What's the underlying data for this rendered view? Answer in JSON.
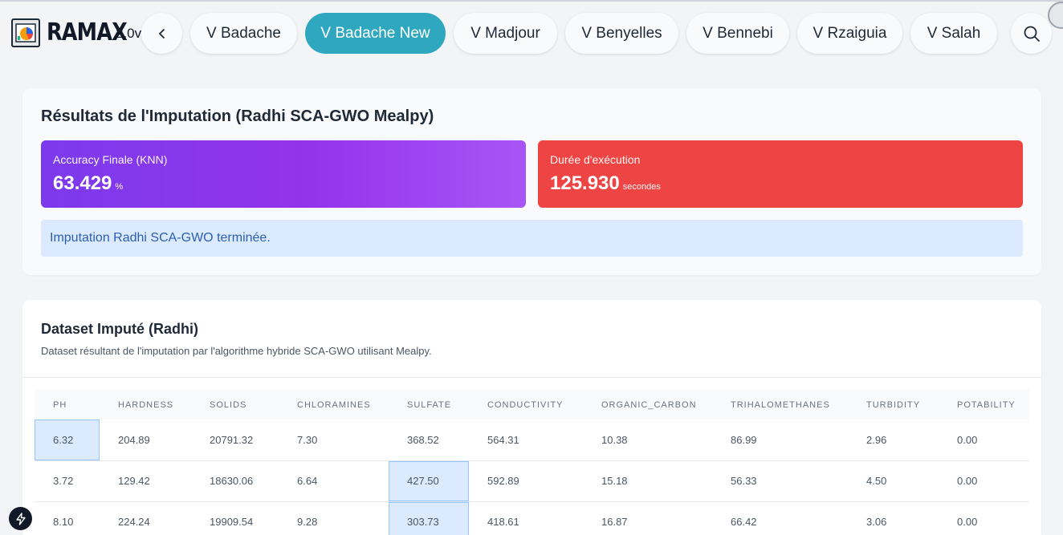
{
  "header": {
    "logo_text": "RAMAX",
    "version": "2.0v",
    "nav": [
      {
        "label": "V Badache",
        "active": false
      },
      {
        "label": "V Badache New",
        "active": true
      },
      {
        "label": "V Madjour",
        "active": false
      },
      {
        "label": "V Benyelles",
        "active": false
      },
      {
        "label": "V Bennebi",
        "active": false
      },
      {
        "label": "V Rzaiguia",
        "active": false
      },
      {
        "label": "V Salah",
        "active": false
      }
    ],
    "back_icon": "chevron-left-icon",
    "search_icon": "search-icon",
    "accent_color": "#2ea7bf"
  },
  "results": {
    "title": "Résultats de l'Imputation (Radhi SCA-GWO Mealpy)",
    "accuracy": {
      "label": "Accuracy Finale (KNN)",
      "value": "63.429",
      "unit": "%"
    },
    "duration": {
      "label": "Durée d'exécution",
      "value": "125.930",
      "unit": "secondes"
    },
    "alert": "Imputation Radhi SCA-GWO terminée."
  },
  "dataset": {
    "title": "Dataset Imputé (Radhi)",
    "subtitle": "Dataset résultant de l'imputation par l'algorithme hybride SCA-GWO utilisant Mealpy.",
    "columns": [
      "PH",
      "HARDNESS",
      "SOLIDS",
      "CHLORAMINES",
      "SULFATE",
      "CONDUCTIVITY",
      "ORGANIC_CARBON",
      "TRIHALOMETHANES",
      "TURBIDITY",
      "POTABILITY"
    ],
    "rows": [
      [
        "6.32",
        "204.89",
        "20791.32",
        "7.30",
        "368.52",
        "564.31",
        "10.38",
        "86.99",
        "2.96",
        "0.00"
      ],
      [
        "3.72",
        "129.42",
        "18630.06",
        "6.64",
        "427.50",
        "592.89",
        "15.18",
        "56.33",
        "4.50",
        "0.00"
      ],
      [
        "8.10",
        "224.24",
        "19909.54",
        "9.28",
        "303.73",
        "418.61",
        "16.87",
        "66.42",
        "3.06",
        "0.00"
      ]
    ]
  }
}
